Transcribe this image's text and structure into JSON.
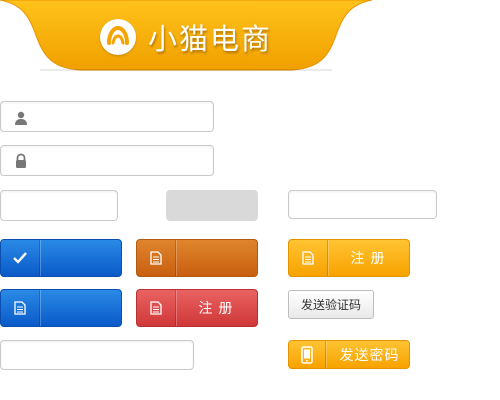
{
  "header": {
    "brand_title": "小猫电商",
    "logo_icon": "arc-logo-icon",
    "banner_color": "#f5a300"
  },
  "form": {
    "username_icon": "user-icon",
    "password_icon": "lock-icon"
  },
  "buttons": {
    "check_icon": "checkmark-icon",
    "doc_icon": "document-icon",
    "phone_icon": "phone-icon",
    "register_label": "注册",
    "send_code_label": "发送验证码",
    "send_password_label": "发送密码"
  },
  "colors": {
    "blue": "#0a5ac8",
    "orange": "#c85f10",
    "yellow": "#f7a200",
    "red": "#cf3838"
  }
}
